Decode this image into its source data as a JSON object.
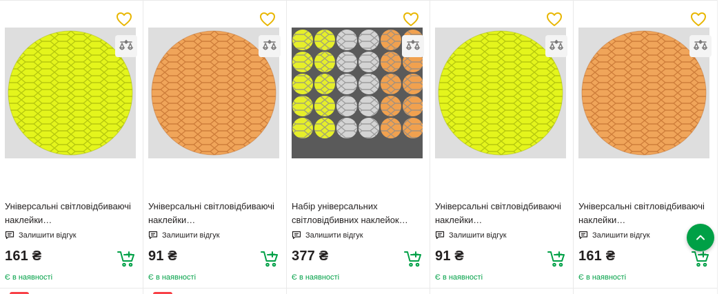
{
  "products": [
    {
      "title": "Універсальні світловідбиваючі наклейки…",
      "review_label": "Залишити відгук",
      "price": "161 ₴",
      "availability": "Є в наявності",
      "image": "yellow-reflective-disc"
    },
    {
      "title": "Універсальні світловідбиваючі наклейки…",
      "review_label": "Залишити відгук",
      "price": "91 ₴",
      "availability": "Є в наявності",
      "image": "orange-reflective-disc"
    },
    {
      "title": "Набір універсальних світловідбивних наклейок…",
      "review_label": "Залишити відгук",
      "price": "377 ₴",
      "availability": "Є в наявності",
      "image": "reflective-stickers-set"
    },
    {
      "title": "Універсальні світловідбиваючі наклейки…",
      "review_label": "Залишити відгук",
      "price": "91 ₴",
      "availability": "Є в наявності",
      "image": "yellow-reflective-disc"
    },
    {
      "title": "Універсальні світловідбиваючі наклейки…",
      "review_label": "Залишити відгук",
      "price": "161 ₴",
      "availability": "Є в наявності",
      "image": "orange-reflective-disc"
    }
  ],
  "icons": {
    "favorite": "heart-icon",
    "compare": "scales-icon",
    "review": "comment-icon",
    "cart": "cart-icon",
    "scroll_top": "chevron-up-icon"
  },
  "colors": {
    "accent_green": "#00a046",
    "favorite_yellow": "#e8b600",
    "badge_red": "#f84147",
    "text": "#221f1f"
  }
}
